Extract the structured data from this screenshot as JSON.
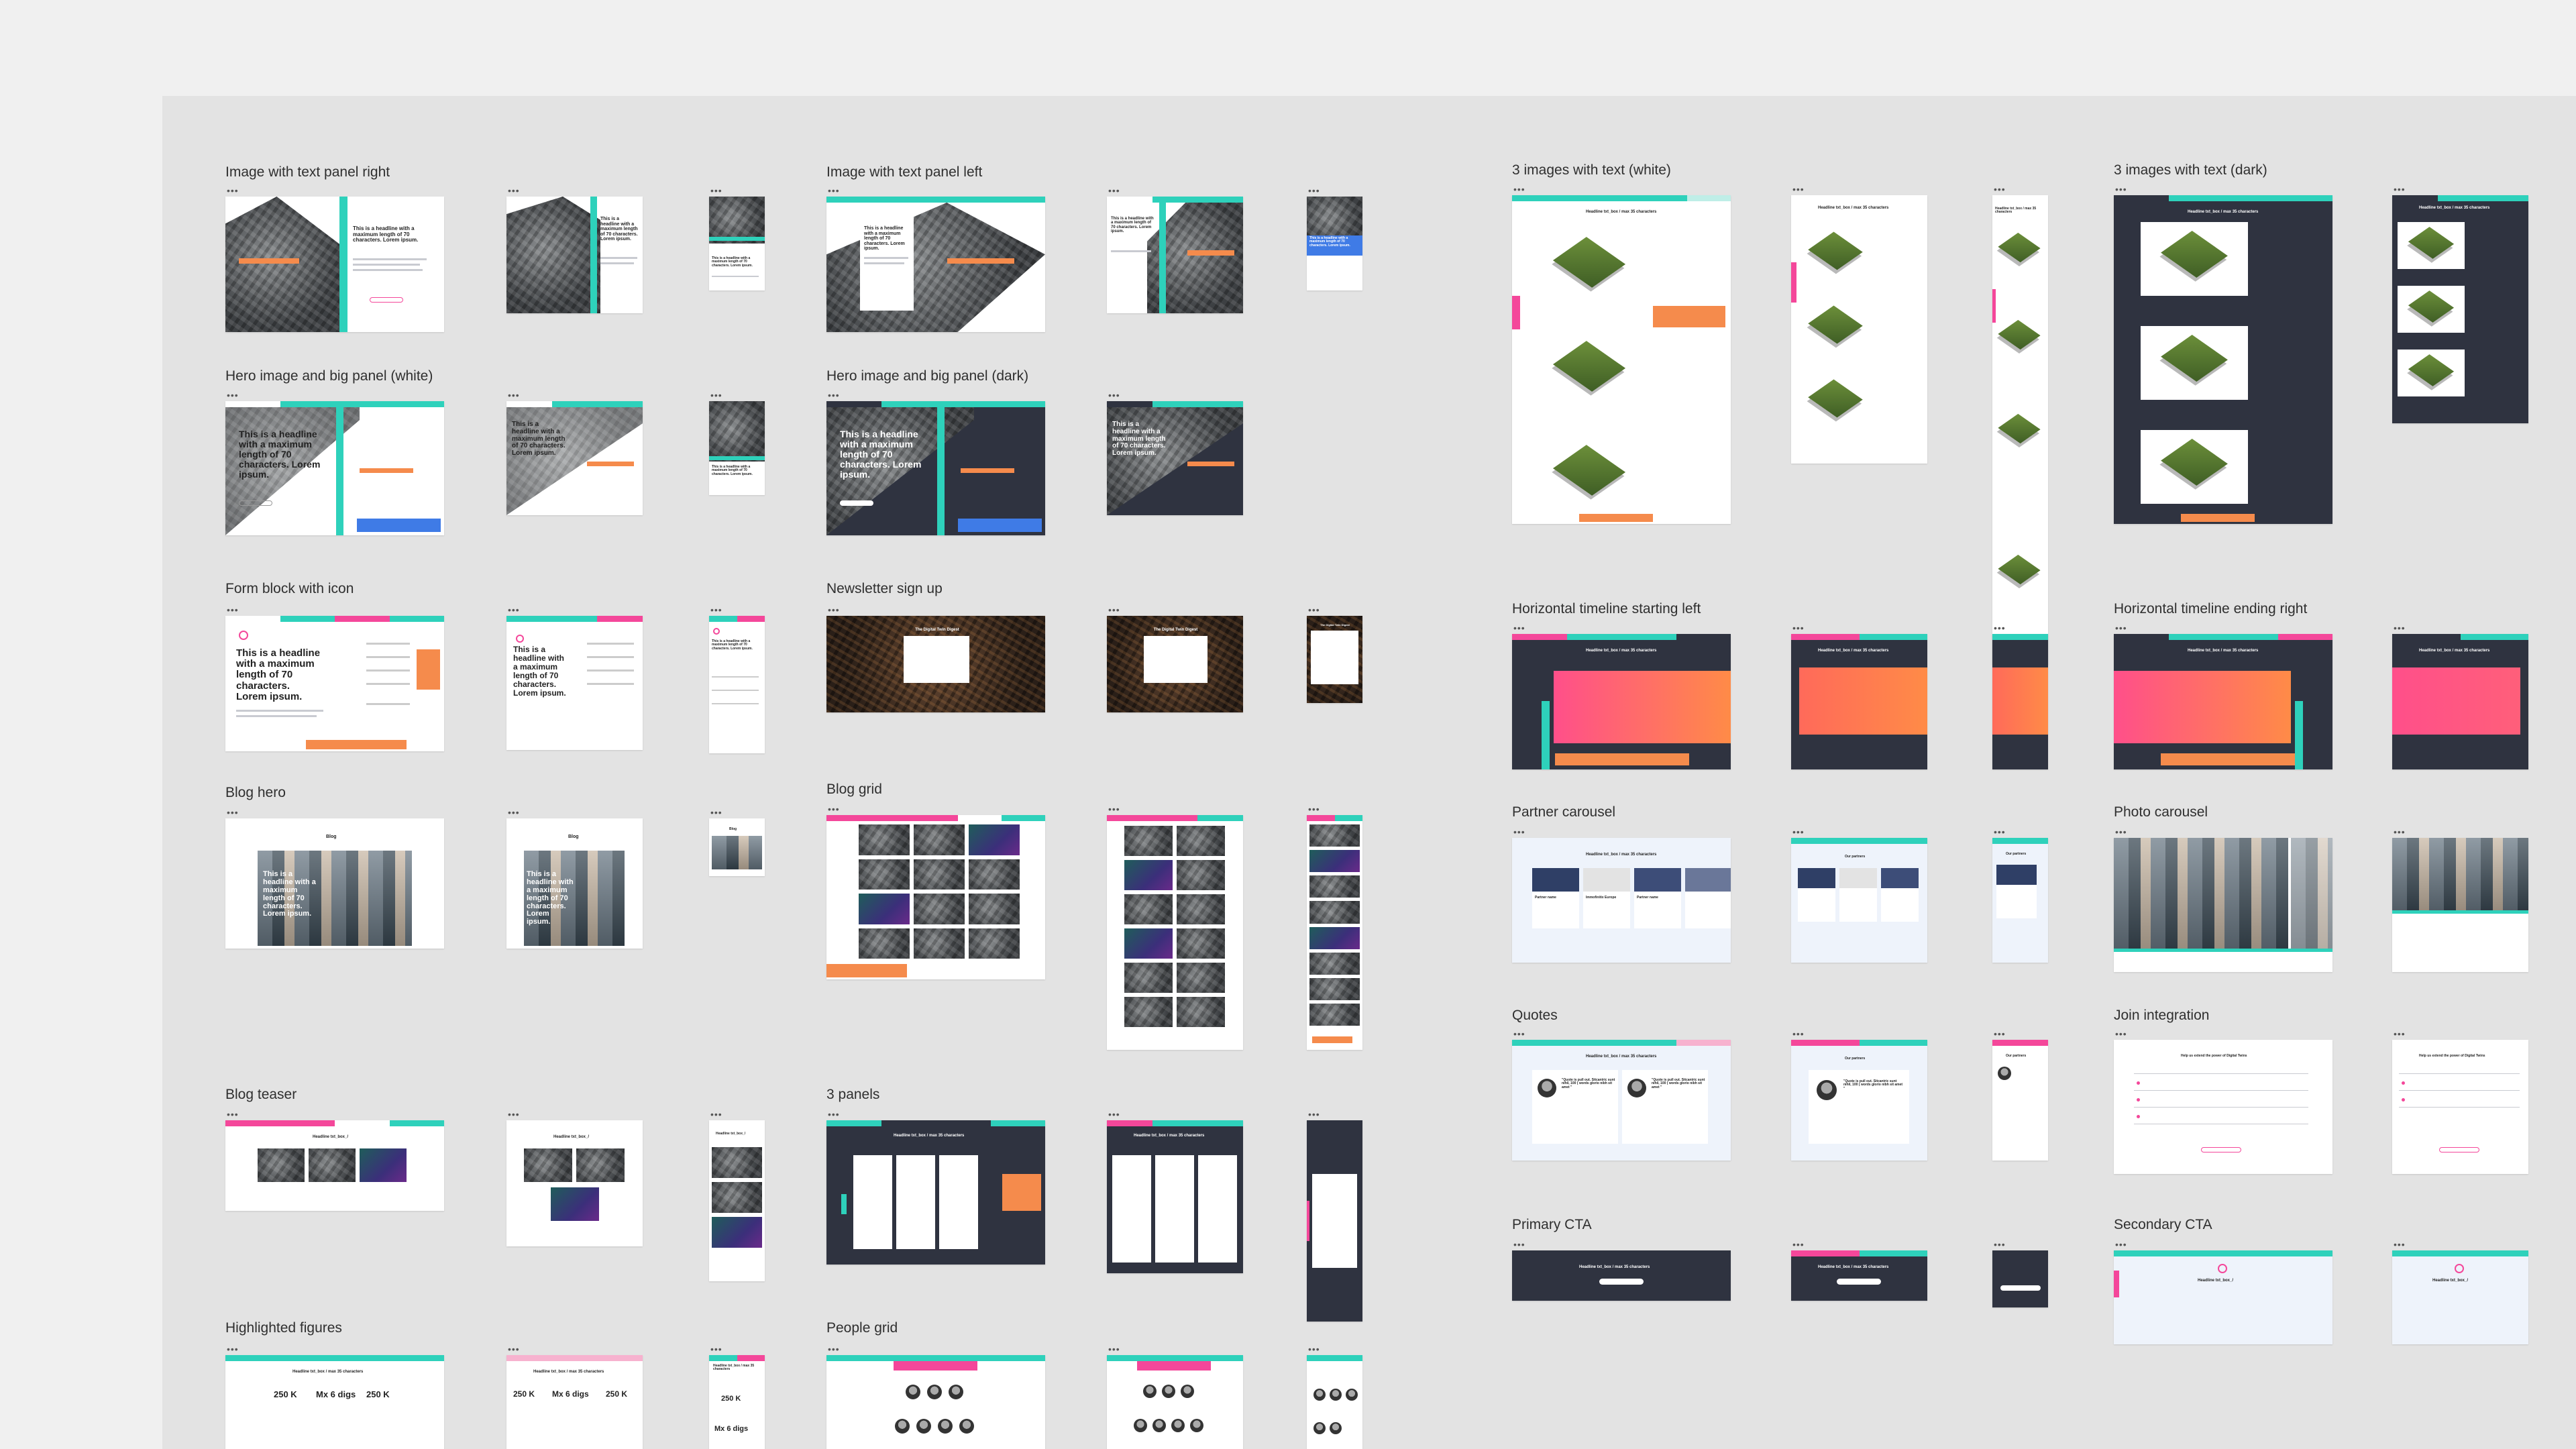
{
  "groups": [
    {
      "label": "Image with text panel right"
    },
    {
      "label": "Image with text panel left"
    },
    {
      "label": "3 images with text (white)"
    },
    {
      "label": "3 images with text (dark)"
    },
    {
      "label": "Hero image and big panel (white)"
    },
    {
      "label": "Hero image and big panel (dark)"
    },
    {
      "label": "Horizontal timeline starting left"
    },
    {
      "label": "Horizontal timeline ending right"
    },
    {
      "label": "Form block with icon"
    },
    {
      "label": "Newsletter sign up"
    },
    {
      "label": "Partner carousel"
    },
    {
      "label": "Photo carousel"
    },
    {
      "label": "Blog hero"
    },
    {
      "label": "Blog grid"
    },
    {
      "label": "Quotes"
    },
    {
      "label": "Join integration"
    },
    {
      "label": "Primary CTA"
    },
    {
      "label": "Secondary CTA"
    },
    {
      "label": "Blog teaser"
    },
    {
      "label": "3 panels"
    },
    {
      "label": "Highlighted figures"
    },
    {
      "label": "People grid"
    }
  ],
  "frame_menu": "•••",
  "samples": {
    "headline_long": "This is a headline with a maximum length of 70 characters. Lorem ipsum.",
    "headline_short": "This is a headline",
    "blog_title": "Blog",
    "headline_35": "Headline txt_box / max 35 characters",
    "headline_box": "Headline txt_box_/",
    "figure_1": "250 K",
    "figure_2": "Mx 6 digs",
    "figure_3": "250 K",
    "partner_name": "Partner name",
    "partner_2": "Immofinitix Europe",
    "our_partners": "Our partners",
    "newsletter_title": "The Digital Twin Digest",
    "quote": "\"Quote is pull out. Sitcantric sunt nihil, 100 ( words glorio nibh sit amet \"",
    "cta_title": "Headline txt_box / max 35 characters",
    "secondary_cta": "Headline txt_box_/",
    "join_title": "Help us extend the power of Digital Twins"
  },
  "colors": {
    "teal": "#2ed1bb",
    "pink": "#f4479a",
    "orange": "#f58b4c",
    "dark": "#2f3340",
    "blue": "#3f7be6",
    "canvas": "#e3e3e3"
  }
}
